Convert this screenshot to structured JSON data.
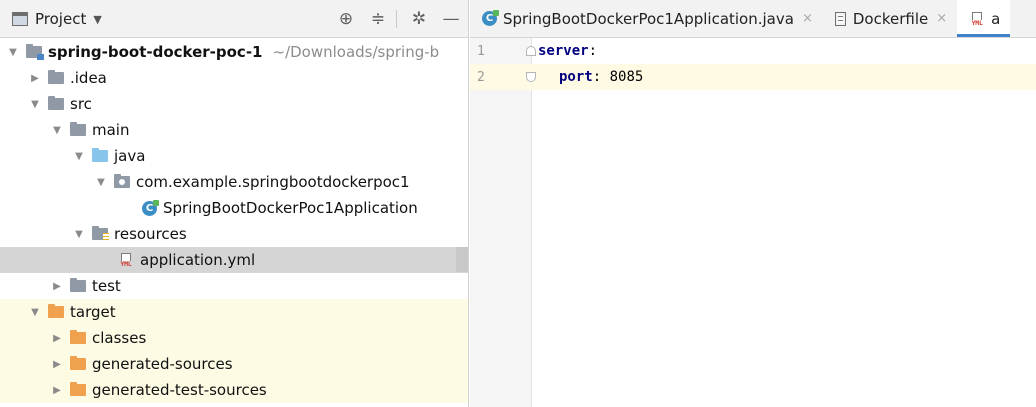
{
  "project_panel": {
    "title": "Project",
    "dropdown_icon": "caret-down-icon",
    "header_buttons": [
      "locate-icon",
      "collapse-all-icon",
      "gear-icon",
      "minimize-icon"
    ],
    "tree": [
      {
        "label": "spring-boot-docker-poc-1",
        "hint": "~/Downloads/spring-b",
        "icon": "module-folder-icon",
        "expanded": "▼"
      },
      {
        "label": ".idea",
        "icon": "folder-icon",
        "expanded": "▶"
      },
      {
        "label": "src",
        "icon": "folder-icon",
        "expanded": "▼"
      },
      {
        "label": "main",
        "icon": "folder-icon",
        "expanded": "▼"
      },
      {
        "label": "java",
        "icon": "source-folder-icon",
        "expanded": "▼"
      },
      {
        "label": "com.example.springbootdockerpoc1",
        "icon": "package-icon",
        "expanded": "▼"
      },
      {
        "label": "SpringBootDockerPoc1Application",
        "icon": "spring-class-icon",
        "badge": "C"
      },
      {
        "label": "resources",
        "icon": "resources-folder-icon",
        "expanded": "▼"
      },
      {
        "label": "application.yml",
        "icon": "yml-file-icon",
        "tag": "YML"
      },
      {
        "label": "test",
        "icon": "folder-icon",
        "expanded": "▶"
      },
      {
        "label": "target",
        "icon": "excluded-folder-icon",
        "expanded": "▼"
      },
      {
        "label": "classes",
        "icon": "excluded-folder-icon",
        "expanded": "▶"
      },
      {
        "label": "generated-sources",
        "icon": "excluded-folder-icon",
        "expanded": "▶"
      },
      {
        "label": "generated-test-sources",
        "icon": "excluded-folder-icon",
        "expanded": "▶"
      }
    ]
  },
  "editor": {
    "tabs": [
      {
        "label": "SpringBootDockerPoc1Application.java",
        "icon": "spring-class-icon",
        "badge": "C",
        "close": "×"
      },
      {
        "label": "Dockerfile",
        "icon": "text-file-icon",
        "close": "×"
      },
      {
        "label": "a",
        "icon": "yml-file-icon",
        "tag": "YML"
      }
    ],
    "lines": [
      {
        "number": "1",
        "key": "server",
        "colon": ":",
        "value": ""
      },
      {
        "number": "2",
        "key": "port",
        "colon": ":",
        "value": " 8085"
      }
    ]
  },
  "colors": {
    "selection": "#d5d5d5",
    "excluded_bg": "#fdfbe4",
    "current_line": "#fefae3",
    "yaml_key": "#000080",
    "active_tab_underline": "#4083c9"
  }
}
